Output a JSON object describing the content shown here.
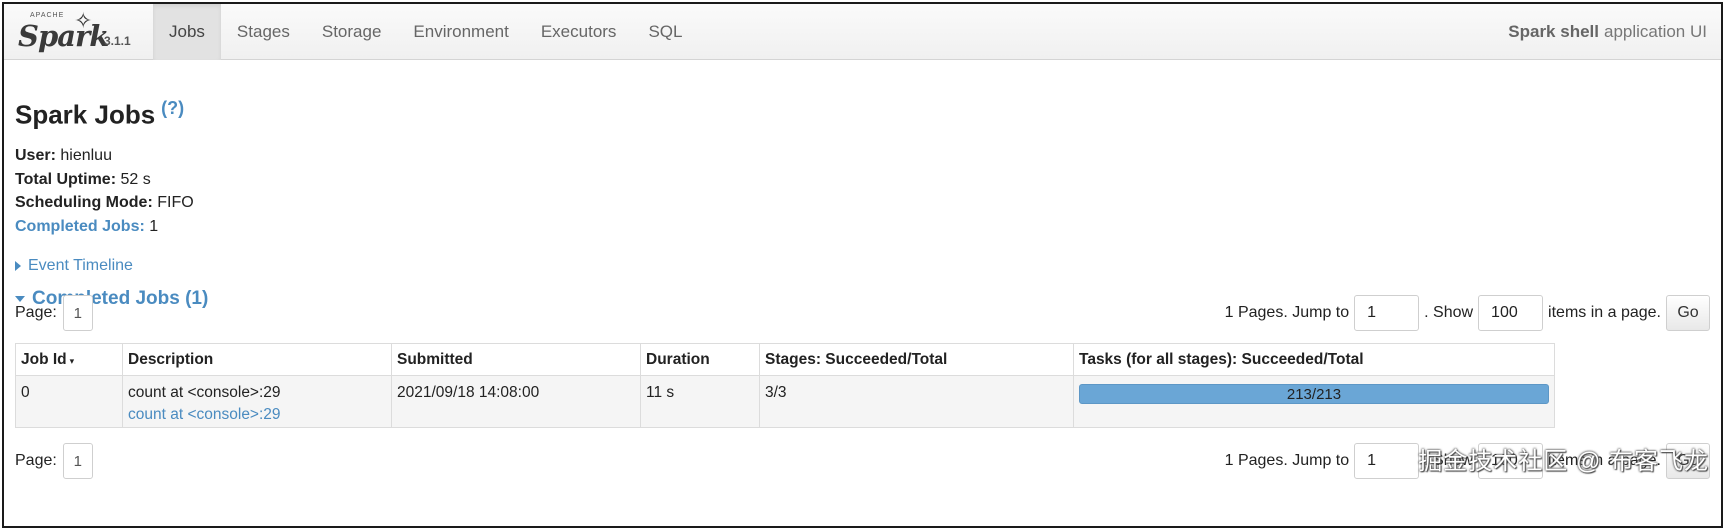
{
  "brand": {
    "apache": "APACHE",
    "name": "Spark",
    "version": "3.1.1"
  },
  "nav": {
    "tabs": [
      {
        "label": "Jobs",
        "active": true
      },
      {
        "label": "Stages"
      },
      {
        "label": "Storage"
      },
      {
        "label": "Environment"
      },
      {
        "label": "Executors"
      },
      {
        "label": "SQL"
      }
    ],
    "app_name": "Spark shell",
    "app_suffix": "application UI"
  },
  "page": {
    "title": "Spark Jobs",
    "help": "(?)",
    "summary": {
      "user_label": "User:",
      "user": "hienluu",
      "uptime_label": "Total Uptime:",
      "uptime": "52 s",
      "mode_label": "Scheduling Mode:",
      "mode": "FIFO",
      "completed_label": "Completed Jobs:",
      "completed": "1"
    },
    "event_timeline": "Event Timeline",
    "completed_section": "Completed Jobs (1)"
  },
  "pagination": {
    "page_label": "Page:",
    "current_page": "1",
    "pages_text": "1 Pages. Jump to",
    "jump_value": "1",
    "show_text": ". Show",
    "show_value": "100",
    "items_text": "items in a page.",
    "go_label": "Go"
  },
  "table": {
    "headers": [
      "Job Id",
      "Description",
      "Submitted",
      "Duration",
      "Stages: Succeeded/Total",
      "Tasks (for all stages): Succeeded/Total"
    ],
    "sort_indicator": "▾",
    "rows": [
      {
        "job_id": "0",
        "description": "count at <console>:29",
        "description_link": "count at <console>:29",
        "submitted": "2021/09/18 14:08:00",
        "duration": "11 s",
        "stages": "3/3",
        "tasks": "213/213",
        "tasks_fraction": 1.0
      }
    ]
  },
  "watermark": "掘金技术社区 @ 布客飞龙",
  "colors": {
    "link": "#4a8bc0",
    "progress": "#6aa6d6"
  }
}
